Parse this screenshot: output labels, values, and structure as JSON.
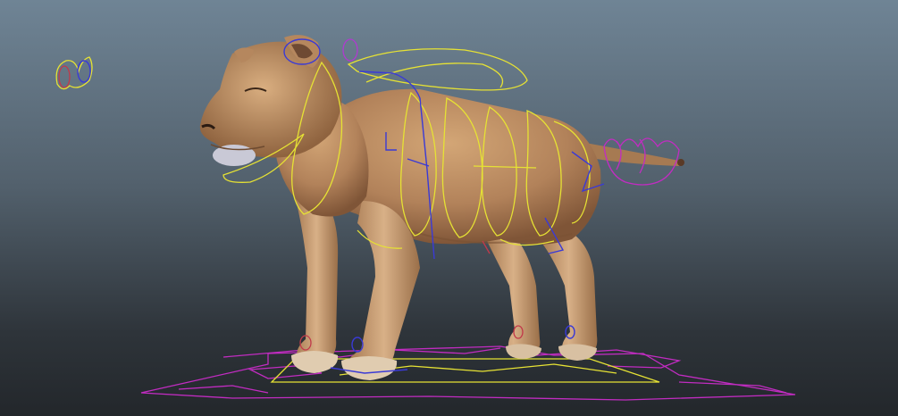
{
  "viewport": {
    "background_top": "#6f8495",
    "background_bottom": "#23272b"
  },
  "model": {
    "subject": "lioness-rig",
    "body_color": "#b88a5c",
    "shade_color": "#8a5f3b",
    "highlight_color": "#d7ad7e"
  },
  "rig_colors": {
    "ik_controls": "#e6e234",
    "fk_controls": "#3a3ad6",
    "ground_controls": "#c22cc2",
    "tail_controls": "#c22cc2",
    "pole_vectors": "#c23a4a"
  }
}
